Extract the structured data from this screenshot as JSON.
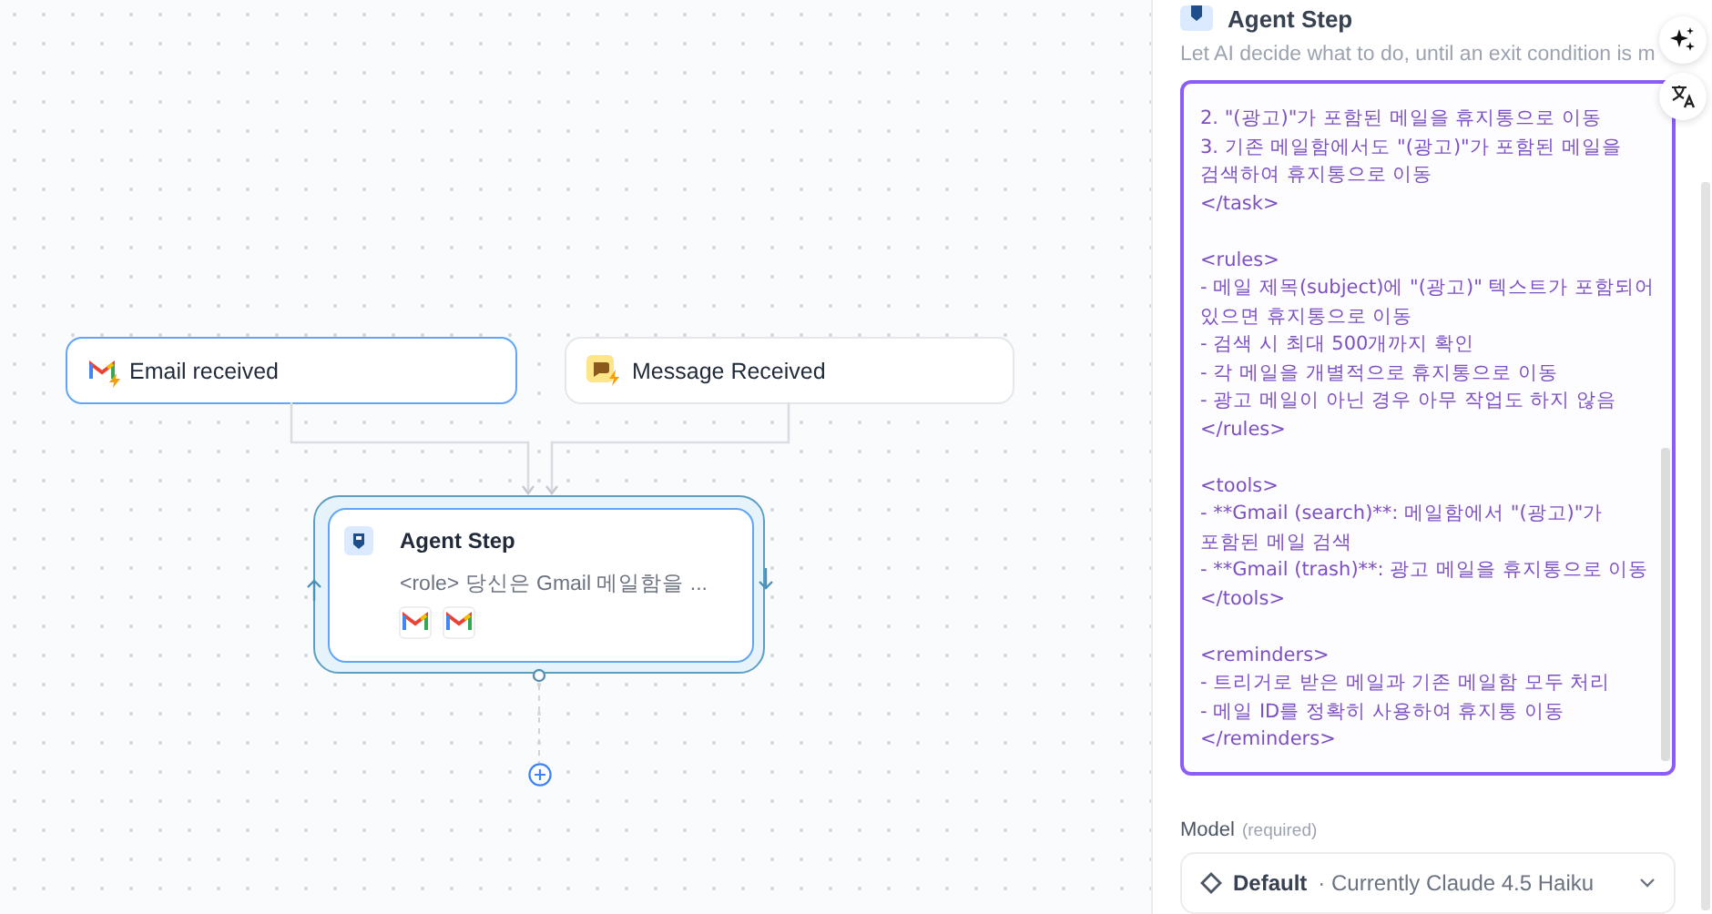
{
  "canvas": {
    "triggers": [
      {
        "kind": "email",
        "label": "Email received",
        "selected": true
      },
      {
        "kind": "message",
        "label": "Message Received",
        "selected": false
      }
    ],
    "agent_node": {
      "title": "Agent Step",
      "preview": "<role> 당신은 Gmail 메일함을 ...",
      "selected": true
    }
  },
  "panel": {
    "title": "Agent Step",
    "description": "Let AI decide what to do, until an exit condition is m",
    "prompt": {
      "value": "2. \"(광고)\"가 포함된 메일을 휴지통으로 이동\n3. 기존 메일함에서도 \"(광고)\"가 포함된 메일을 검색하여 휴지통으로 이동\n</task>\n\n<rules>\n- 메일 제목(subject)에 \"(광고)\" 텍스트가 포함되어 있으면 휴지통으로 이동\n- 검색 시 최대 500개까지 확인\n- 각 메일을 개별적으로 휴지통으로 이동\n- 광고 메일이 아닌 경우 아무 작업도 하지 않음\n</rules>\n\n<tools>\n- **Gmail (search)**: 메일함에서 \"(광고)\"가 포함된 메일 검색\n- **Gmail (trash)**: 광고 메일을 휴지통으로 이동\n</tools>\n\n<reminders>\n- 트리거로 받은 메일과 기존 메일함 모두 처리\n- 메일 ID를 정확히 사용하여 휴지통 이동\n</reminders>"
    },
    "model": {
      "label": "Model",
      "hint": "(required)",
      "value": "Default",
      "detail": "· Currently Claude 4.5 Haiku"
    }
  }
}
